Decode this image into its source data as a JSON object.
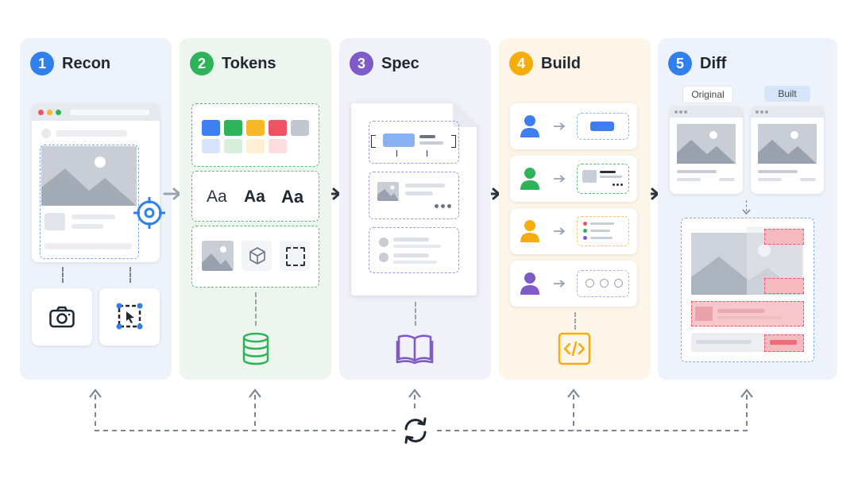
{
  "steps": [
    {
      "number": "1",
      "title": "Recon",
      "color": "#2f80ed"
    },
    {
      "number": "2",
      "title": "Tokens",
      "color": "#2fb35a"
    },
    {
      "number": "3",
      "title": "Spec",
      "color": "#7e5bc9"
    },
    {
      "number": "4",
      "title": "Build",
      "color": "#f5ad0e"
    },
    {
      "number": "5",
      "title": "Diff",
      "color": "#2f80ed"
    }
  ],
  "tokens": {
    "typography_samples": [
      "Aa",
      "Aa",
      "Aa"
    ],
    "swatch_colors": [
      "#3d7ff0",
      "#2fb35a",
      "#f7b92a",
      "#ef5261",
      "#c2c7cf"
    ],
    "tint_colors": [
      "#d8e4fb",
      "#d8efdd",
      "#fdf0d4",
      "#fcdde0"
    ]
  },
  "diff": {
    "original_label": "Original",
    "built_label": "Built"
  },
  "icons": {
    "recon": [
      "camera-icon",
      "select-cursor-icon",
      "target-crosshair-icon"
    ],
    "tokens": "database-icon",
    "spec": "book-icon",
    "build": "code-icon",
    "loop": "refresh-cycle-icon"
  }
}
